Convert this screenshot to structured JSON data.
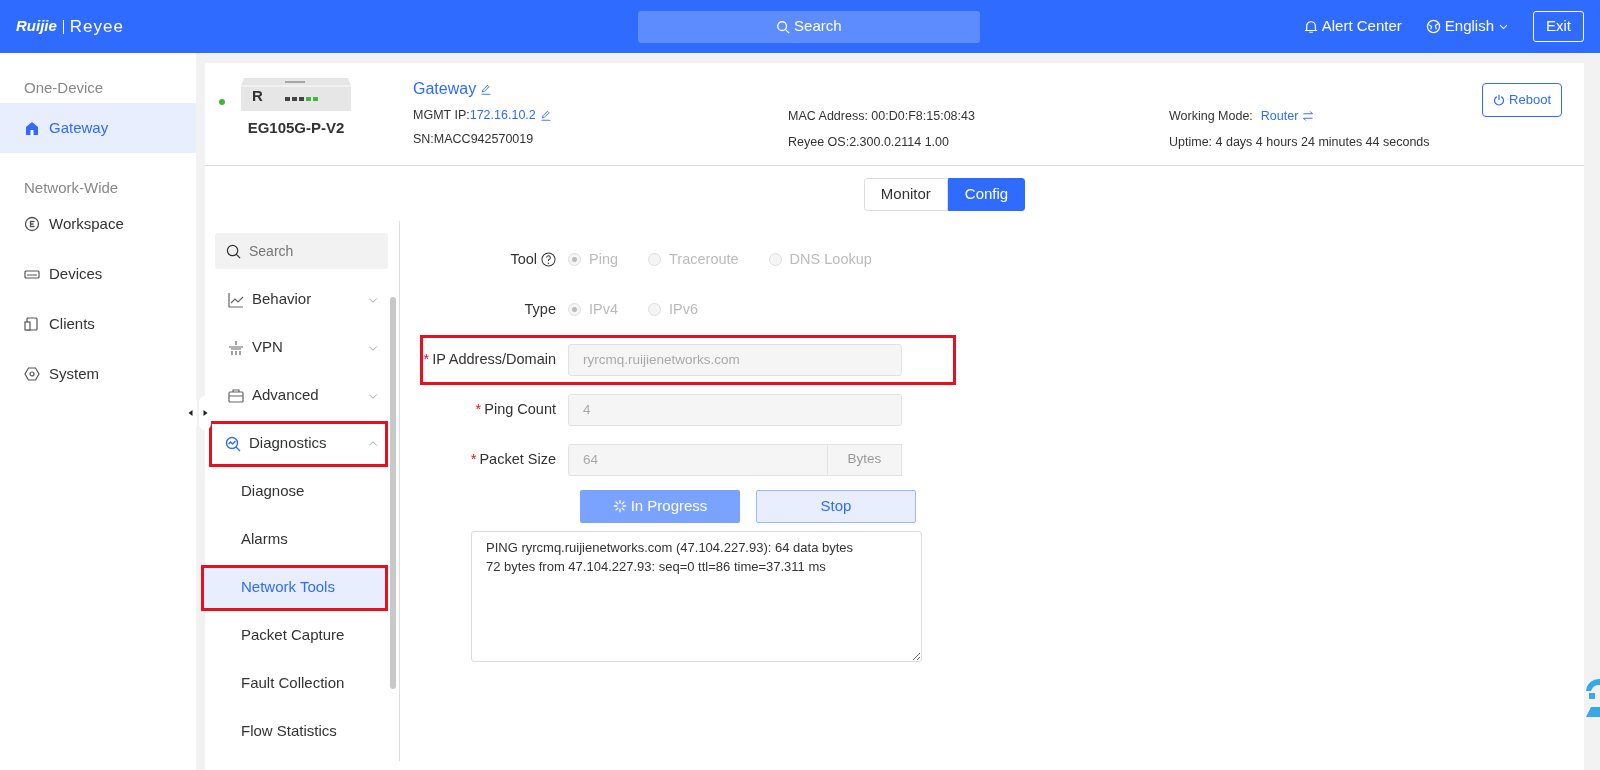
{
  "header": {
    "brand": "Ruijie",
    "product": "Reyee",
    "search": "Search",
    "alert_center": "Alert Center",
    "language": "English",
    "exit": "Exit"
  },
  "sidebar": {
    "sections": [
      {
        "heading": "One-Device",
        "items": [
          {
            "label": "Gateway",
            "selected": true
          }
        ]
      },
      {
        "heading": "Network-Wide",
        "items": [
          {
            "label": "Workspace",
            "selected": false
          },
          {
            "label": "Devices",
            "selected": false
          },
          {
            "label": "Clients",
            "selected": false
          },
          {
            "label": "System",
            "selected": false
          }
        ]
      }
    ]
  },
  "device": {
    "online": true,
    "image_label": "R",
    "model": "EG105G-P-V2",
    "name": "Gateway",
    "mgmt_ip_label": "MGMT IP:",
    "mgmt_ip": "172.16.10.2",
    "sn": "SN:MACC942570019",
    "mac": "MAC Address: 00:D0:F8:15:08:43",
    "os": "Reyee OS:2.300.0.2114 1.00",
    "working_mode_label": "Working Mode:",
    "working_mode": "Router",
    "uptime": "Uptime: 4 days 4 hours 24 minutes 44 seconds",
    "reboot": "Reboot"
  },
  "view_tabs": [
    {
      "label": "Monitor",
      "selected": false
    },
    {
      "label": "Config",
      "selected": true
    }
  ],
  "menu": {
    "search": {
      "placeholder": "Search"
    },
    "items": [
      {
        "label": "Behavior",
        "expanded": false,
        "highlighted": false
      },
      {
        "label": "VPN",
        "expanded": false,
        "highlighted": false
      },
      {
        "label": "Advanced",
        "expanded": false,
        "highlighted": false
      },
      {
        "label": "Diagnostics",
        "expanded": true,
        "highlighted": true,
        "children": [
          {
            "label": "Diagnose",
            "selected": false,
            "highlighted": false
          },
          {
            "label": "Alarms",
            "selected": false,
            "highlighted": false
          },
          {
            "label": "Network Tools",
            "selected": true,
            "highlighted": true
          },
          {
            "label": "Packet Capture",
            "selected": false,
            "highlighted": false
          },
          {
            "label": "Fault Collection",
            "selected": false,
            "highlighted": false
          },
          {
            "label": "Flow Statistics",
            "selected": false,
            "highlighted": false
          }
        ]
      }
    ]
  },
  "form": {
    "disabled": true,
    "radio_groups": [
      {
        "label": "Tool",
        "help": true,
        "options": [
          {
            "label": "Ping",
            "selected": true
          },
          {
            "label": "Traceroute",
            "selected": false
          },
          {
            "label": "DNS Lookup",
            "selected": false
          }
        ]
      },
      {
        "label": "Type",
        "help": false,
        "options": [
          {
            "label": "IPv4",
            "selected": true
          },
          {
            "label": "IPv6",
            "selected": false
          }
        ]
      }
    ],
    "fields": [
      {
        "label": "IP Address/Domain",
        "required_mark": "*",
        "value": "ryrcmq.ruijienetworks.com",
        "highlighted": true
      },
      {
        "label": "Ping Count",
        "required_mark": "*",
        "value": "4",
        "highlighted": false
      },
      {
        "label": "Packet Size",
        "required_mark": "*",
        "value": "64",
        "addon": "Bytes",
        "highlighted": false
      }
    ],
    "start_button": {
      "label": "In Progress",
      "loading": true
    },
    "stop_button": {
      "label": "Stop"
    },
    "output": [
      "PING ryrcmq.ruijienetworks.com (47.104.227.93): 64 data bytes",
      "72 bytes from 47.104.227.93: seq=0 ttl=86 time=37.311 ms"
    ]
  }
}
